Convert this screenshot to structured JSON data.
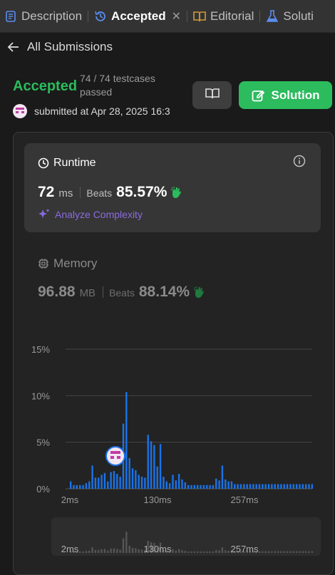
{
  "tabs": [
    {
      "label": "Description",
      "icon": "document-icon",
      "active": false
    },
    {
      "label": "Accepted",
      "icon": "history-icon",
      "active": true
    },
    {
      "label": "Editorial",
      "icon": "book-icon",
      "active": false
    },
    {
      "label": "Soluti",
      "icon": "flask-icon",
      "active": false
    }
  ],
  "back_label": "All Submissions",
  "submission": {
    "status": "Accepted",
    "testcases": "74 / 74 testcases passed",
    "submitted": "submitted at Apr 28, 2025 16:3"
  },
  "buttons": {
    "solution": "Solution"
  },
  "runtime": {
    "title": "Runtime",
    "value": "72",
    "unit": "ms",
    "beats_label": "Beats",
    "beats": "85.57%",
    "analyze": "Analyze Complexity"
  },
  "memory": {
    "title": "Memory",
    "value": "96.88",
    "unit": "MB",
    "beats_label": "Beats",
    "beats": "88.14%"
  },
  "colors": {
    "accent_green": "#2cbb5d",
    "bar_blue": "#1a73e8",
    "analyze_purple": "#8b6be0"
  },
  "chart_data": {
    "type": "bar",
    "title": "",
    "xlabel": "",
    "ylabel": "",
    "y_ticks": [
      "15%",
      "10%",
      "5%",
      "0%"
    ],
    "x_ticks": [
      "2ms",
      "130ms",
      "257ms"
    ],
    "ylim": [
      0,
      15
    ],
    "values": [
      0.8,
      0.4,
      0.4,
      0.4,
      0.4,
      0.6,
      0.8,
      2.5,
      1.2,
      1.2,
      1.5,
      1.7,
      0.8,
      1.8,
      1.9,
      1.6,
      1.3,
      7.0,
      10.4,
      3.3,
      2.2,
      2.0,
      1.5,
      1.3,
      1.2,
      5.8,
      5.1,
      4.7,
      2.4,
      4.8,
      1.3,
      0.8,
      0.6,
      1.5,
      0.9,
      1.6,
      1.0,
      0.7,
      0.4,
      0.4,
      0.4,
      0.4,
      0.4,
      0.4,
      0.4,
      0.4,
      0.4,
      1.1,
      0.9,
      2.5,
      1.0,
      0.8,
      0.8,
      0.5,
      0.5,
      0.5,
      0.5,
      0.5,
      0.5,
      0.5,
      0.5,
      0.5,
      0.5,
      0.5,
      0.5,
      0.5,
      0.5,
      0.5,
      0.5,
      0.5,
      0.5,
      0.5,
      0.5,
      0.5,
      0.5,
      0.5,
      0.5,
      0.5,
      0.5
    ],
    "highlight_index": 17,
    "grid": true
  }
}
